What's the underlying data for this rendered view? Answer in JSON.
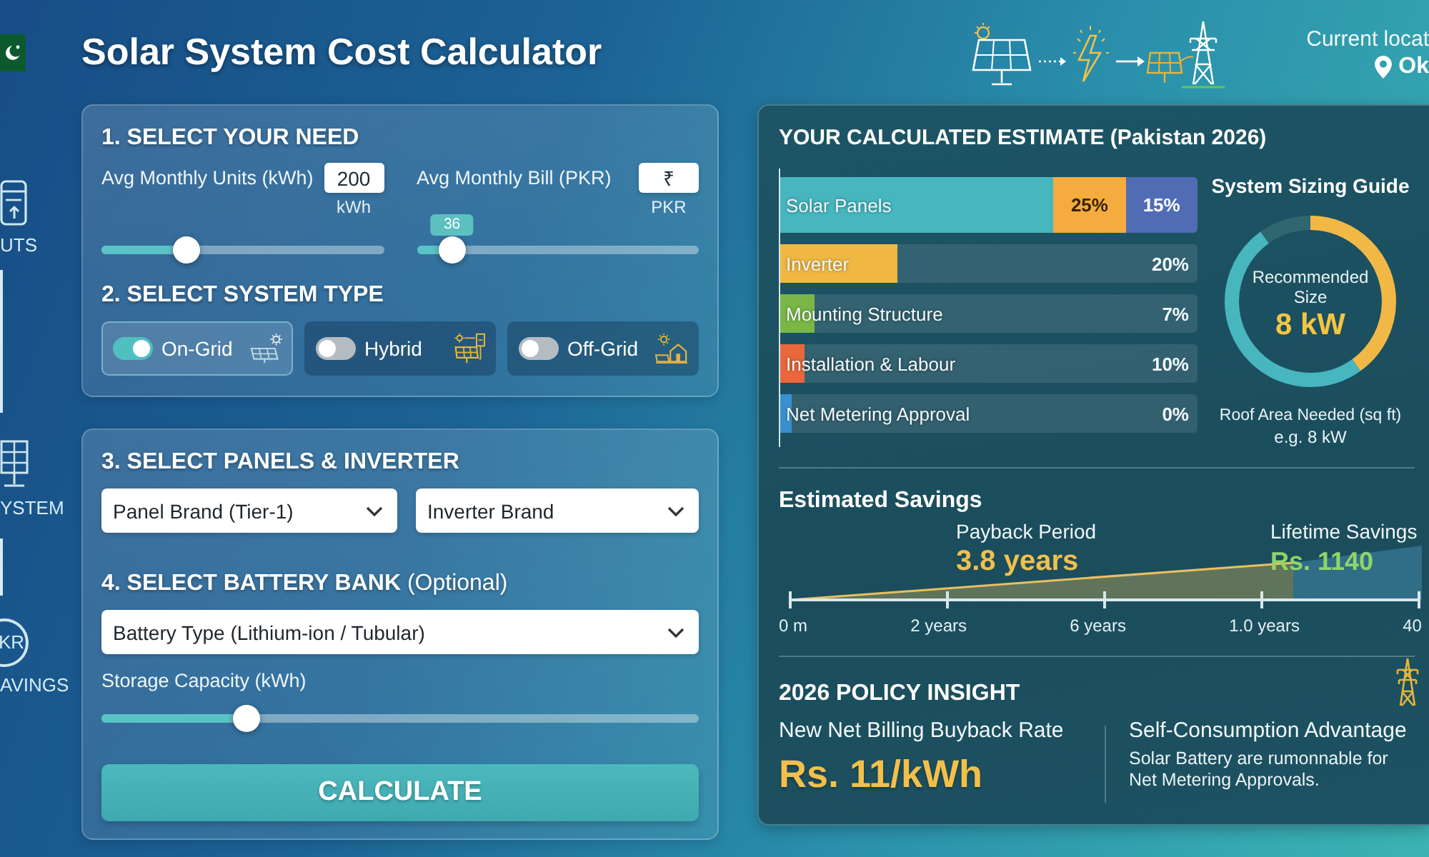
{
  "header": {
    "title": "Solar System Cost Calculator",
    "location_label": "Current locat",
    "location_value": "Ok"
  },
  "sidebar": {
    "items": [
      {
        "kind": "form",
        "label": "UTS"
      },
      {
        "kind": "panel",
        "label": "YSTEM"
      },
      {
        "kind": "currency",
        "badge": "KR",
        "label": "AVINGS"
      }
    ]
  },
  "need": {
    "heading": "1. SELECT YOUR NEED",
    "inputs": [
      {
        "label": "Avg Monthly Units (kWh)",
        "value": "200",
        "unit": "kWh",
        "level": 0.255
      },
      {
        "label": "Avg Monthly Bill (PKR)",
        "value": "₹",
        "unit": "PKR",
        "tooltip": "36",
        "level": 0.08
      }
    ]
  },
  "system_type": {
    "heading": "2. SELECT SYSTEM TYPE",
    "options": [
      {
        "kind": "on-grid",
        "label": "On-Grid",
        "selected": true
      },
      {
        "kind": "hybrid",
        "label": "Hybrid",
        "selected": false
      },
      {
        "kind": "off-grid",
        "label": "Off-Grid",
        "selected": false
      }
    ]
  },
  "equipment": {
    "heading": "3. SELECT PANELS & INVERTER",
    "dropdowns": [
      "Panel Brand (Tier-1)",
      "Inverter Brand"
    ]
  },
  "battery": {
    "heading": "**4. SELECT BATTERY BANK** (Optional)",
    "dropdown": "Battery Type (Lithium-ion / Tubular)",
    "capacity_label": "Storage Capacity (kWh)",
    "level": 0.22
  },
  "calculate_button": "CALCULATE",
  "estimate": {
    "title": "YOUR CALCULATED ESTIMATE (Pakistan 2026)",
    "breakdown": [
      {
        "label": "Solar Panels",
        "level": 0.655,
        "color": "#47b6bf",
        "tags": [
          {
            "value": "25%",
            "color": "#f4ac3e"
          },
          {
            "value": "15%",
            "color": "#4f6cb5"
          }
        ]
      },
      {
        "label": "Inverter",
        "value": "20%",
        "level": 0.28,
        "color": "#f0b842"
      },
      {
        "label": "Mounting Structure",
        "value": "7%",
        "level": 0.082,
        "color": "#7ab648"
      },
      {
        "label": "Installation & Labour",
        "value": "10%",
        "level": 0.058,
        "color": "#e8683c"
      },
      {
        "label": "Net Metering Approval",
        "value": "0%",
        "level": 0.027,
        "color": "#3a8fd0"
      }
    ]
  },
  "sizing": {
    "title": "System Sizing Guide",
    "ring_label": "Recommended Size",
    "size": "8 kW",
    "level": 0.4,
    "roof_label": "Roof Area Needed (sq ft)",
    "roof_value": "e.g. 8 kW"
  },
  "savings": {
    "title": "Estimated Savings",
    "payback_label": "Payback Period",
    "payback_value": "3.8 years",
    "lifetime_label": "Lifetime Savings",
    "lifetime_value": "Rs. 1140",
    "axis_labels": [
      "0 m",
      "2 years",
      "6 years",
      "1.0 years",
      "40"
    ]
  },
  "policy": {
    "title": "2026 POLICY INSIGHT",
    "rate_label": "New Net Billing Buyback Rate",
    "rate_value": "Rs. 11/kWh",
    "advantage_title": "Self-Consumption Advantage",
    "advantage_note": "Solar Battery are rumonnable for Net Metering Approvals."
  }
}
